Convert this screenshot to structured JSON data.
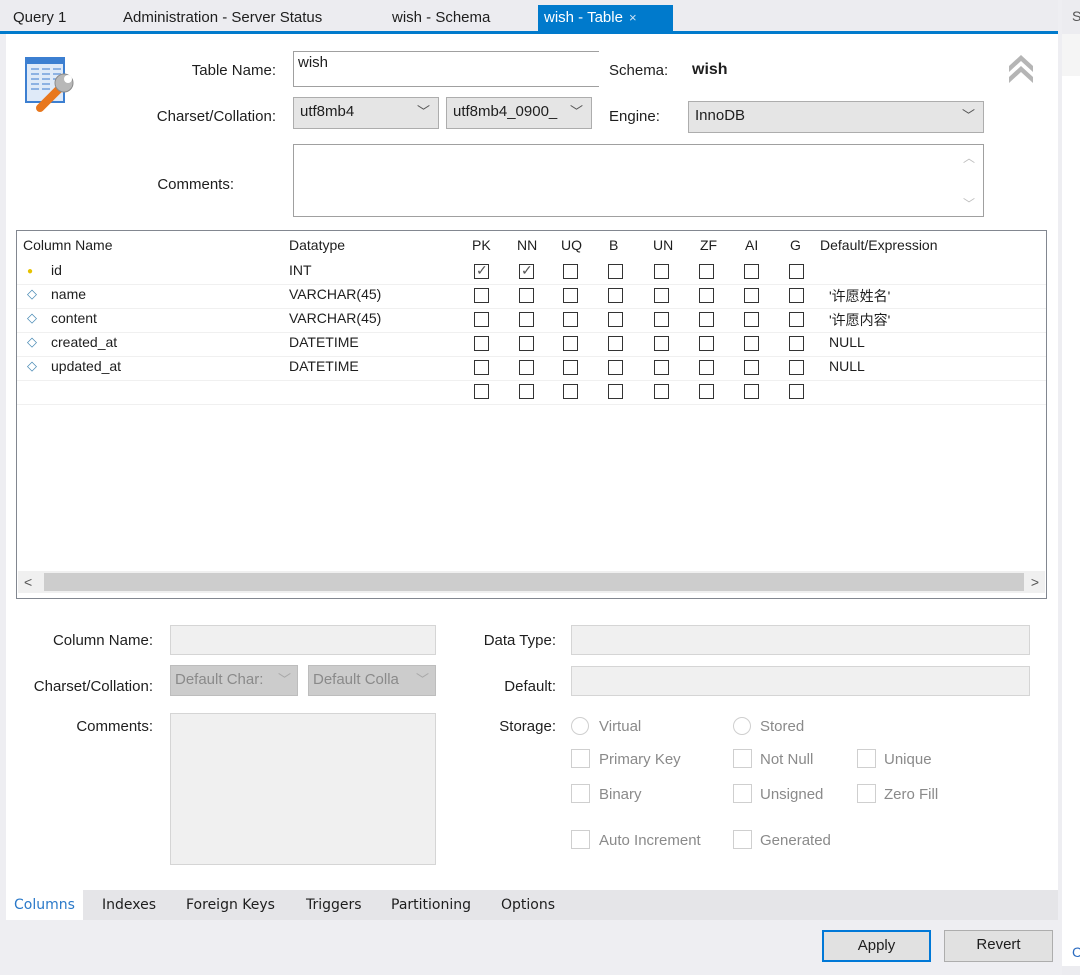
{
  "tabs": [
    {
      "label": "Query 1",
      "active": false
    },
    {
      "label": "Administration - Server Status",
      "active": false
    },
    {
      "label": "wish - Schema",
      "active": false
    },
    {
      "label": "wish - Table",
      "active": true,
      "close": "×"
    }
  ],
  "right_panel": {
    "clipped_label": "S",
    "clipped_link": "C"
  },
  "header": {
    "table_name_label": "Table Name:",
    "table_name_value": "wish",
    "schema_label": "Schema:",
    "schema_value": "wish",
    "charset_label": "Charset/Collation:",
    "charset_value": "utf8mb4",
    "collation_value": "utf8mb4_0900_",
    "engine_label": "Engine:",
    "engine_value": "InnoDB",
    "comments_label": "Comments:",
    "comments_value": "",
    "collapse_icon": "double-chevron-up"
  },
  "grid": {
    "headers": [
      "Column Name",
      "Datatype",
      "PK",
      "NN",
      "UQ",
      "B",
      "UN",
      "ZF",
      "AI",
      "G",
      "Default/Expression"
    ],
    "rows": [
      {
        "icon": "key",
        "name": "id",
        "datatype": "INT",
        "flags": [
          true,
          true,
          false,
          false,
          false,
          false,
          false,
          false
        ],
        "default": ""
      },
      {
        "icon": "diamond",
        "name": "name",
        "datatype": "VARCHAR(45)",
        "flags": [
          false,
          false,
          false,
          false,
          false,
          false,
          false,
          false
        ],
        "default": "'许愿姓名'"
      },
      {
        "icon": "diamond",
        "name": "content",
        "datatype": "VARCHAR(45)",
        "flags": [
          false,
          false,
          false,
          false,
          false,
          false,
          false,
          false
        ],
        "default": "'许愿内容'"
      },
      {
        "icon": "diamond",
        "name": "created_at",
        "datatype": "DATETIME",
        "flags": [
          false,
          false,
          false,
          false,
          false,
          false,
          false,
          false
        ],
        "default": "NULL"
      },
      {
        "icon": "diamond",
        "name": "updated_at",
        "datatype": "DATETIME",
        "flags": [
          false,
          false,
          false,
          false,
          false,
          false,
          false,
          false
        ],
        "default": "NULL"
      },
      {
        "icon": "",
        "name": "",
        "datatype": "",
        "flags": [
          false,
          false,
          false,
          false,
          false,
          false,
          false,
          false
        ],
        "default": ""
      }
    ],
    "scroll_left": "<",
    "scroll_right": ">"
  },
  "details": {
    "column_name_label": "Column Name:",
    "column_name_value": "",
    "charset_label": "Charset/Collation:",
    "charset_value": "Default Char:",
    "collation_value": "Default Colla",
    "comments_label": "Comments:",
    "data_type_label": "Data Type:",
    "data_type_value": "",
    "default_label": "Default:",
    "default_value": "",
    "storage_label": "Storage:",
    "storage_options": [
      "Virtual",
      "Stored"
    ],
    "checkboxes": [
      "Primary Key",
      "Not Null",
      "Unique",
      "Binary",
      "Unsigned",
      "Zero Fill",
      "Auto Increment",
      "Generated"
    ]
  },
  "subtabs": [
    {
      "label": "Columns",
      "active": true
    },
    {
      "label": "Indexes",
      "active": false
    },
    {
      "label": "Foreign Keys",
      "active": false
    },
    {
      "label": "Triggers",
      "active": false
    },
    {
      "label": "Partitioning",
      "active": false
    },
    {
      "label": "Options",
      "active": false
    }
  ],
  "actions": {
    "apply": "Apply",
    "revert": "Revert"
  },
  "colors": {
    "accent": "#007acc",
    "active_subtab_text": "#2a79c9"
  }
}
